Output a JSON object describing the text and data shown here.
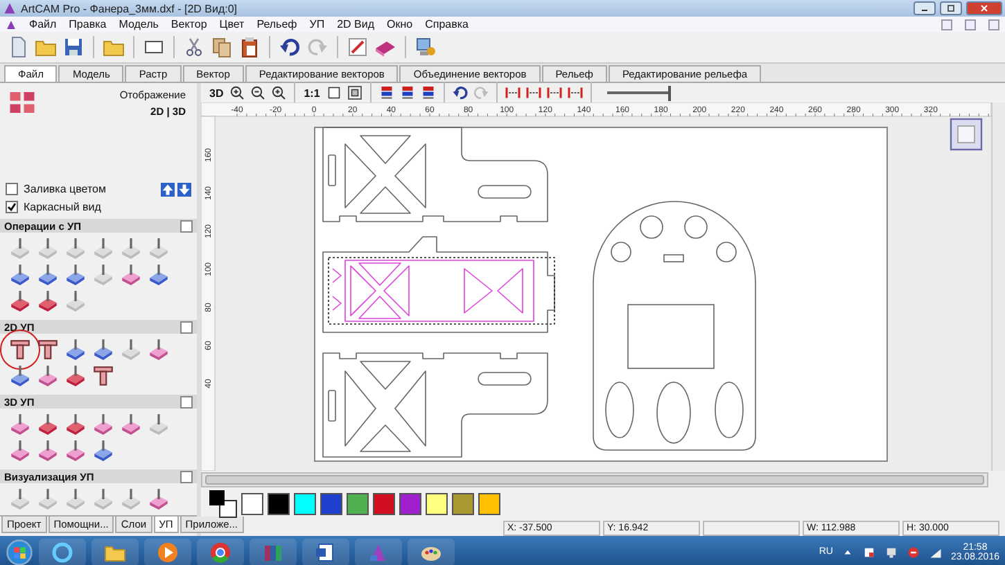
{
  "window": {
    "title": "ArtCAM Pro - Фанера_3мм.dxf - [2D Вид:0]"
  },
  "menu": [
    "Файл",
    "Правка",
    "Модель",
    "Вектор",
    "Цвет",
    "Рельеф",
    "УП",
    "2D Вид",
    "Окно",
    "Справка"
  ],
  "ribbon_tabs": [
    {
      "label": "Файл",
      "selected": true
    },
    {
      "label": "Модель",
      "selected": false
    },
    {
      "label": "Растр",
      "selected": false
    },
    {
      "label": "Вектор",
      "selected": false
    },
    {
      "label": "Редактирование векторов",
      "selected": false
    },
    {
      "label": "Объединение векторов",
      "selected": false
    },
    {
      "label": "Рельеф",
      "selected": false
    },
    {
      "label": "Редактирование рельефа",
      "selected": false
    }
  ],
  "left_panel": {
    "header": "Отображение",
    "view_toggle": "2D | 3D",
    "options": [
      {
        "label": "Заливка цветом",
        "checked": false
      },
      {
        "label": "Каркасный вид",
        "checked": true
      }
    ],
    "sections": [
      {
        "title": "Операции с УП"
      },
      {
        "title": "2D УП"
      },
      {
        "title": "3D УП"
      },
      {
        "title": "Визуализация УП"
      }
    ],
    "tabs": [
      {
        "label": "Проект",
        "selected": false
      },
      {
        "label": "Помощни...",
        "selected": false
      },
      {
        "label": "Слои",
        "selected": false
      },
      {
        "label": "УП",
        "selected": true
      },
      {
        "label": "Приложе...",
        "selected": false
      }
    ]
  },
  "view_toolbar": {
    "mode_label": "3D",
    "scale_label": "1:1",
    "zoom_slider": {
      "level": 1.0
    }
  },
  "canvas": {
    "x_ruler": [
      "-40",
      "-20",
      "0",
      "20",
      "40",
      "60",
      "80",
      "100",
      "120",
      "140",
      "160",
      "180",
      "200",
      "220",
      "240",
      "260",
      "280",
      "300",
      "320"
    ],
    "y_ruler": [
      "160",
      "140",
      "120",
      "100",
      "80",
      "60",
      "40"
    ]
  },
  "palette": [
    {
      "color": "#ffffff"
    },
    {
      "color": "#000000"
    },
    {
      "color": "#00ffff"
    },
    {
      "color": "#2040d0"
    },
    {
      "color": "#50b050"
    },
    {
      "color": "#d01020"
    },
    {
      "color": "#a020d0"
    },
    {
      "color": "#ffff80"
    },
    {
      "color": "#a89830"
    },
    {
      "color": "#ffc000"
    }
  ],
  "status_bar": [
    "X: -37.500",
    "Y: 16.942",
    "W: 112.988",
    "H: 30.000"
  ],
  "taskbar": {
    "language": "RU",
    "time": "21:58",
    "date": "23.08.2016"
  }
}
